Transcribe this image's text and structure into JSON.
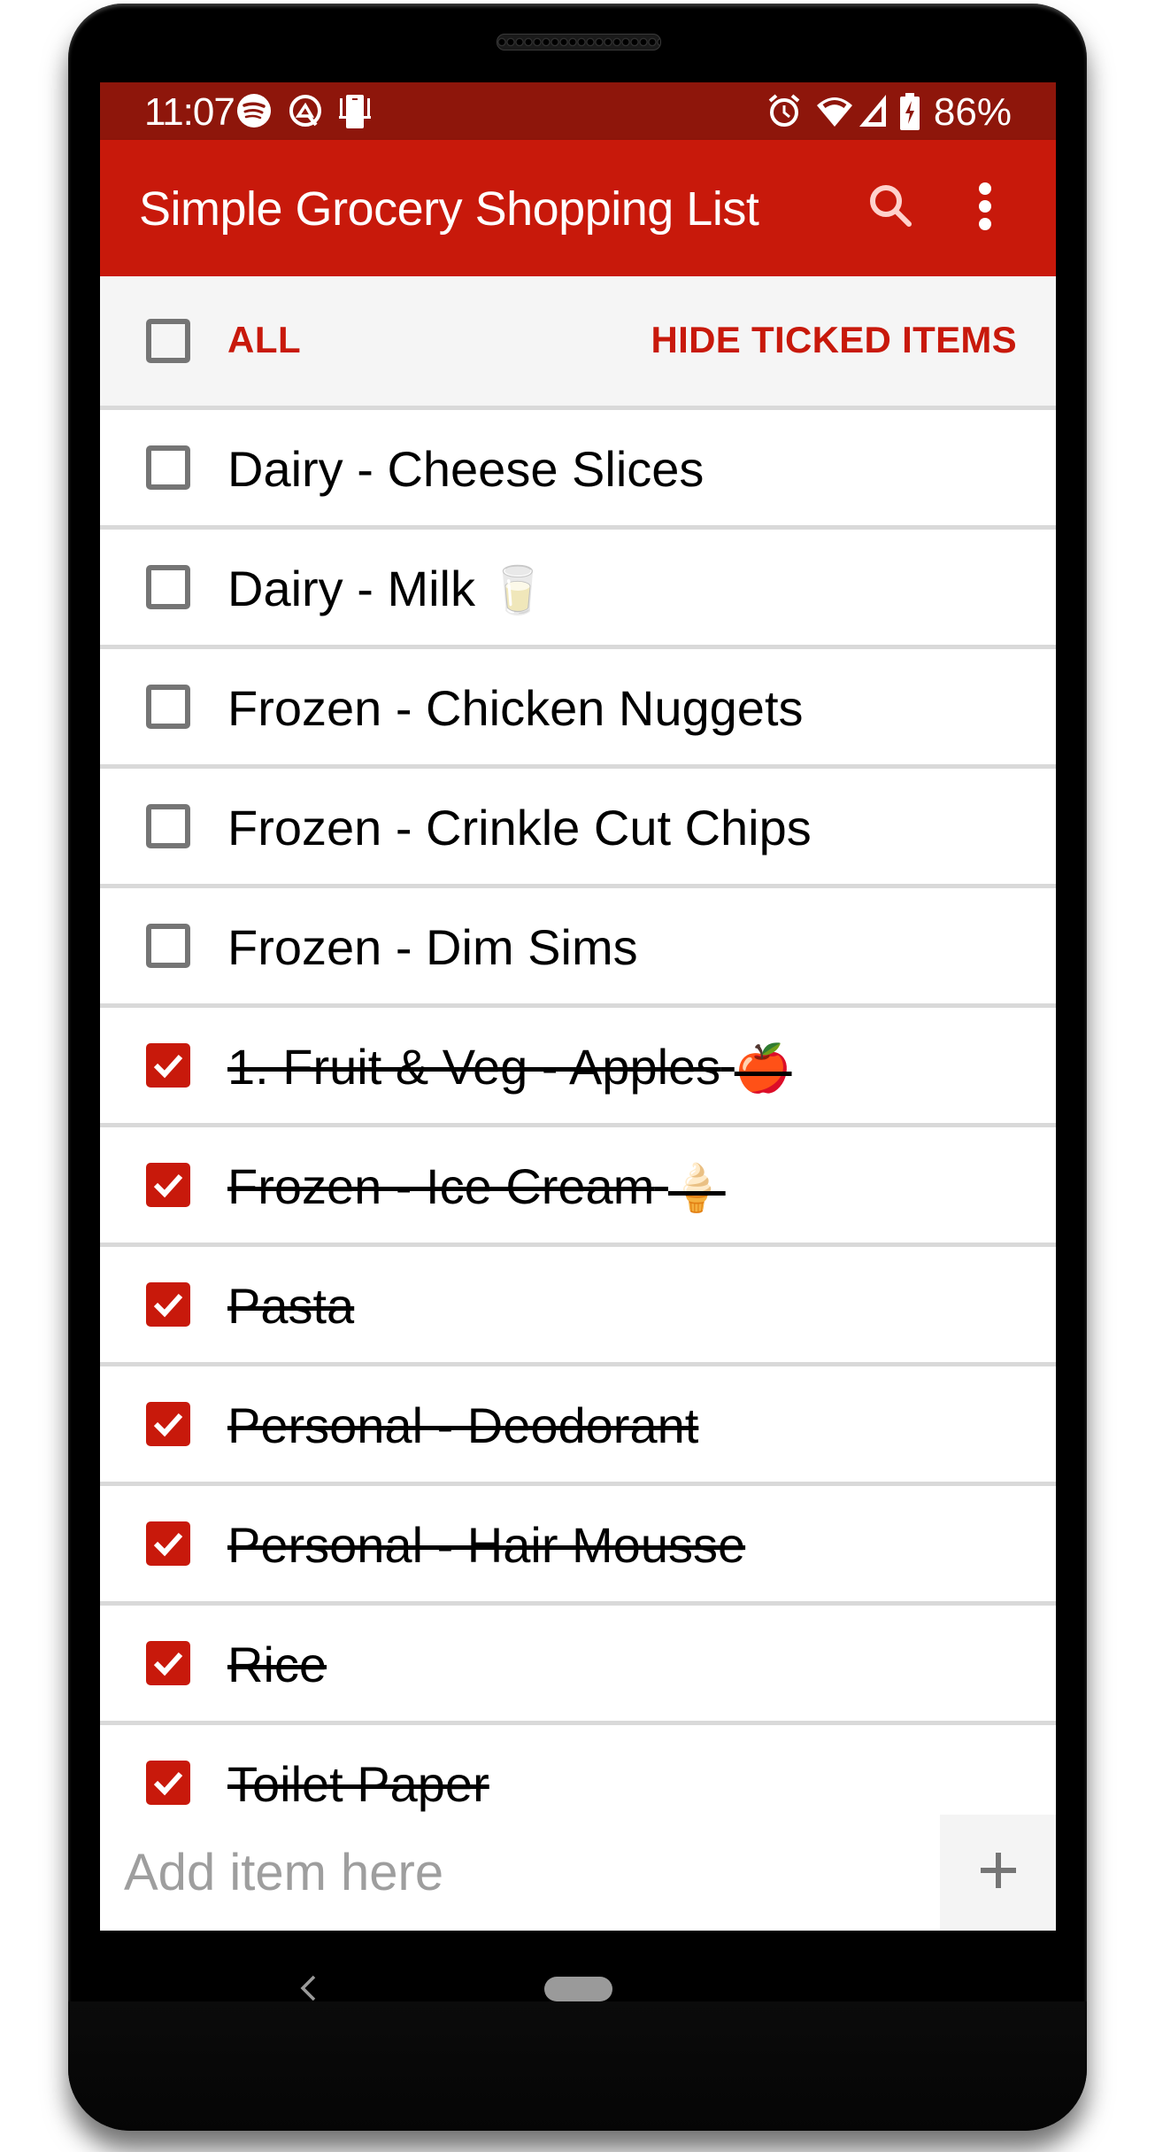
{
  "status_bar": {
    "time": "11:07",
    "left_icons": [
      "spotify-icon",
      "quick-icon",
      "cast-phone-icon"
    ],
    "right_icons": [
      "alarm-icon",
      "wifi-icon",
      "signal-icon",
      "battery-charging-icon"
    ],
    "battery_percent": "86%"
  },
  "toolbar": {
    "title": "Simple Grocery Shopping List",
    "actions": [
      "search-icon",
      "more-vert-icon"
    ]
  },
  "subheader": {
    "select_all_label": "ALL",
    "select_all_checked": false,
    "hide_ticked_label": "HIDE TICKED ITEMS"
  },
  "items": [
    {
      "label": "Dairy - Cheese Slices",
      "emoji": "",
      "checked": false
    },
    {
      "label": "Dairy - Milk",
      "emoji": "🥛",
      "checked": false
    },
    {
      "label": "Frozen - Chicken Nuggets",
      "emoji": "",
      "checked": false
    },
    {
      "label": "Frozen - Crinkle Cut Chips",
      "emoji": "",
      "checked": false
    },
    {
      "label": "Frozen - Dim Sims",
      "emoji": "",
      "checked": false
    },
    {
      "label": "1. Fruit & Veg - Apples",
      "emoji": "🍎",
      "checked": true
    },
    {
      "label": "Frozen - Ice Cream",
      "emoji": "🍦",
      "checked": true
    },
    {
      "label": "Pasta",
      "emoji": "",
      "checked": true
    },
    {
      "label": "Personal - Deodorant",
      "emoji": "",
      "checked": true
    },
    {
      "label": "Personal - Hair Mousse",
      "emoji": "",
      "checked": true
    },
    {
      "label": "Rice",
      "emoji": "",
      "checked": true
    },
    {
      "label": "Toilet Paper",
      "emoji": "",
      "checked": true
    }
  ],
  "add_item": {
    "placeholder": "Add item here",
    "value": "",
    "button_icon": "plus-icon"
  },
  "colors": {
    "status_bar": "#8e160b",
    "primary": "#c8190b",
    "subheader_bg": "#f5f5f5",
    "divider": "#d9d9d9"
  }
}
